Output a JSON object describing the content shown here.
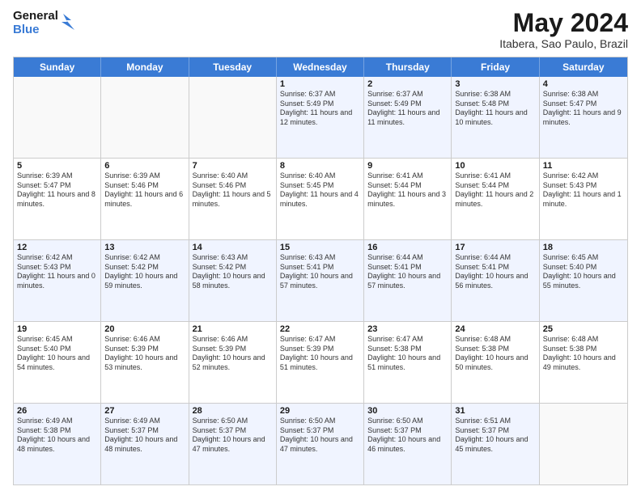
{
  "header": {
    "logo_line1": "General",
    "logo_line2": "Blue",
    "month_year": "May 2024",
    "location": "Itabera, Sao Paulo, Brazil"
  },
  "weekdays": [
    "Sunday",
    "Monday",
    "Tuesday",
    "Wednesday",
    "Thursday",
    "Friday",
    "Saturday"
  ],
  "rows": [
    [
      {
        "day": "",
        "info": ""
      },
      {
        "day": "",
        "info": ""
      },
      {
        "day": "",
        "info": ""
      },
      {
        "day": "1",
        "info": "Sunrise: 6:37 AM\nSunset: 5:49 PM\nDaylight: 11 hours and 12 minutes."
      },
      {
        "day": "2",
        "info": "Sunrise: 6:37 AM\nSunset: 5:49 PM\nDaylight: 11 hours and 11 minutes."
      },
      {
        "day": "3",
        "info": "Sunrise: 6:38 AM\nSunset: 5:48 PM\nDaylight: 11 hours and 10 minutes."
      },
      {
        "day": "4",
        "info": "Sunrise: 6:38 AM\nSunset: 5:47 PM\nDaylight: 11 hours and 9 minutes."
      }
    ],
    [
      {
        "day": "5",
        "info": "Sunrise: 6:39 AM\nSunset: 5:47 PM\nDaylight: 11 hours and 8 minutes."
      },
      {
        "day": "6",
        "info": "Sunrise: 6:39 AM\nSunset: 5:46 PM\nDaylight: 11 hours and 6 minutes."
      },
      {
        "day": "7",
        "info": "Sunrise: 6:40 AM\nSunset: 5:46 PM\nDaylight: 11 hours and 5 minutes."
      },
      {
        "day": "8",
        "info": "Sunrise: 6:40 AM\nSunset: 5:45 PM\nDaylight: 11 hours and 4 minutes."
      },
      {
        "day": "9",
        "info": "Sunrise: 6:41 AM\nSunset: 5:44 PM\nDaylight: 11 hours and 3 minutes."
      },
      {
        "day": "10",
        "info": "Sunrise: 6:41 AM\nSunset: 5:44 PM\nDaylight: 11 hours and 2 minutes."
      },
      {
        "day": "11",
        "info": "Sunrise: 6:42 AM\nSunset: 5:43 PM\nDaylight: 11 hours and 1 minute."
      }
    ],
    [
      {
        "day": "12",
        "info": "Sunrise: 6:42 AM\nSunset: 5:43 PM\nDaylight: 11 hours and 0 minutes."
      },
      {
        "day": "13",
        "info": "Sunrise: 6:42 AM\nSunset: 5:42 PM\nDaylight: 10 hours and 59 minutes."
      },
      {
        "day": "14",
        "info": "Sunrise: 6:43 AM\nSunset: 5:42 PM\nDaylight: 10 hours and 58 minutes."
      },
      {
        "day": "15",
        "info": "Sunrise: 6:43 AM\nSunset: 5:41 PM\nDaylight: 10 hours and 57 minutes."
      },
      {
        "day": "16",
        "info": "Sunrise: 6:44 AM\nSunset: 5:41 PM\nDaylight: 10 hours and 57 minutes."
      },
      {
        "day": "17",
        "info": "Sunrise: 6:44 AM\nSunset: 5:41 PM\nDaylight: 10 hours and 56 minutes."
      },
      {
        "day": "18",
        "info": "Sunrise: 6:45 AM\nSunset: 5:40 PM\nDaylight: 10 hours and 55 minutes."
      }
    ],
    [
      {
        "day": "19",
        "info": "Sunrise: 6:45 AM\nSunset: 5:40 PM\nDaylight: 10 hours and 54 minutes."
      },
      {
        "day": "20",
        "info": "Sunrise: 6:46 AM\nSunset: 5:39 PM\nDaylight: 10 hours and 53 minutes."
      },
      {
        "day": "21",
        "info": "Sunrise: 6:46 AM\nSunset: 5:39 PM\nDaylight: 10 hours and 52 minutes."
      },
      {
        "day": "22",
        "info": "Sunrise: 6:47 AM\nSunset: 5:39 PM\nDaylight: 10 hours and 51 minutes."
      },
      {
        "day": "23",
        "info": "Sunrise: 6:47 AM\nSunset: 5:38 PM\nDaylight: 10 hours and 51 minutes."
      },
      {
        "day": "24",
        "info": "Sunrise: 6:48 AM\nSunset: 5:38 PM\nDaylight: 10 hours and 50 minutes."
      },
      {
        "day": "25",
        "info": "Sunrise: 6:48 AM\nSunset: 5:38 PM\nDaylight: 10 hours and 49 minutes."
      }
    ],
    [
      {
        "day": "26",
        "info": "Sunrise: 6:49 AM\nSunset: 5:38 PM\nDaylight: 10 hours and 48 minutes."
      },
      {
        "day": "27",
        "info": "Sunrise: 6:49 AM\nSunset: 5:37 PM\nDaylight: 10 hours and 48 minutes."
      },
      {
        "day": "28",
        "info": "Sunrise: 6:50 AM\nSunset: 5:37 PM\nDaylight: 10 hours and 47 minutes."
      },
      {
        "day": "29",
        "info": "Sunrise: 6:50 AM\nSunset: 5:37 PM\nDaylight: 10 hours and 47 minutes."
      },
      {
        "day": "30",
        "info": "Sunrise: 6:50 AM\nSunset: 5:37 PM\nDaylight: 10 hours and 46 minutes."
      },
      {
        "day": "31",
        "info": "Sunrise: 6:51 AM\nSunset: 5:37 PM\nDaylight: 10 hours and 45 minutes."
      },
      {
        "day": "",
        "info": ""
      }
    ]
  ]
}
